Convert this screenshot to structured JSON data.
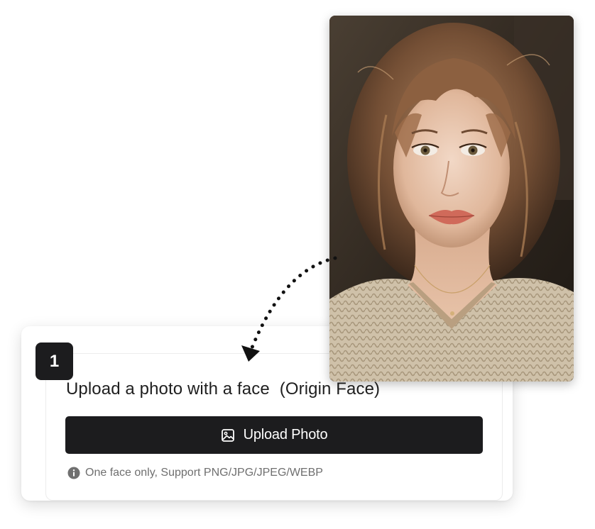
{
  "step": {
    "number": "1"
  },
  "upload": {
    "title": "Upload a photo with a face",
    "title_note": "(Origin Face)",
    "button_label": "Upload Photo",
    "hint": "One face only, Support PNG/JPG/JPEG/WEBP"
  },
  "icons": {
    "button": "image-icon",
    "hint": "info-icon",
    "arrow": "dotted-arrow-icon"
  },
  "colors": {
    "button_bg": "#1c1c1e",
    "button_text": "#ffffff",
    "hint_text": "#6f6f6f",
    "title_text": "#1f1f1f"
  }
}
